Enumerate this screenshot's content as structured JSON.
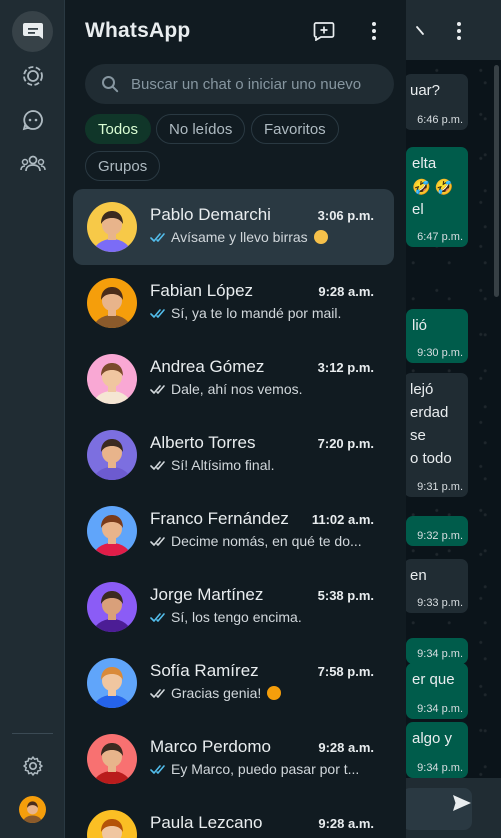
{
  "app": {
    "title": "WhatsApp"
  },
  "rail": {
    "items": [
      "chats-icon",
      "status-icon",
      "channels-icon",
      "communities-icon"
    ],
    "bottom": [
      "settings-icon",
      "profile-avatar"
    ]
  },
  "header": {
    "icons": [
      "new-chat-icon",
      "menu-icon"
    ]
  },
  "search": {
    "placeholder": "Buscar un chat o iniciar uno nuevo"
  },
  "filters": [
    "Todos",
    "No leídos",
    "Favoritos",
    "Grupos"
  ],
  "chats": [
    {
      "name": "Pablo Demarchi",
      "time": "3:06 p.m.",
      "preview": "Avísame y llevo birras",
      "read": true,
      "emoji": "yum",
      "avatar_color": "#f7c948",
      "skin": "#e8b48b",
      "hair": "#3b2a20",
      "shirt": "#7b6cf6"
    },
    {
      "name": "Fabian López",
      "time": "9:28 a.m.",
      "preview": "Sí, ya te lo mandé por mail.",
      "read": true,
      "avatar_color": "#f59e0b",
      "skin": "#e8b48b",
      "hair": "#4a2c1a",
      "shirt": "#8b5a2b"
    },
    {
      "name": "Andrea Gómez",
      "time": "3:12 p.m.",
      "preview": "Dale, ahí nos vemos.",
      "read": false,
      "avatar_color": "#f9a8d4",
      "skin": "#f0c6a0",
      "hair": "#7a4a2a",
      "shirt": "#f5e6d3"
    },
    {
      "name": "Alberto Torres",
      "time": "7:20 p.m.",
      "preview": "Sí! Altísimo final.",
      "read": false,
      "avatar_color": "#7c6fe0",
      "skin": "#e8b48b",
      "hair": "#3b2a20",
      "shirt": "#6d5bd0"
    },
    {
      "name": "Franco Fernández",
      "time": "11:02 a.m.",
      "preview": "Decime nomás, en qué te do...",
      "read": false,
      "avatar_color": "#60a5fa",
      "skin": "#e8b48b",
      "hair": "#7a3b1a",
      "shirt": "#e11d48"
    },
    {
      "name": "Jorge Martínez",
      "time": "5:38 p.m.",
      "preview": "Sí, los tengo encima.",
      "read": true,
      "avatar_color": "#8b5cf6",
      "skin": "#d9a07a",
      "hair": "#3b2a20",
      "shirt": "#4c1d95"
    },
    {
      "name": "Sofía Ramírez",
      "time": "7:58 p.m.",
      "preview": "Gracias genia!",
      "read": false,
      "emoji": "party",
      "avatar_color": "#60a5fa",
      "skin": "#f0c6a0",
      "hair": "#d98a3a",
      "shirt": "#2563eb"
    },
    {
      "name": "Marco Perdomo",
      "time": "9:28 a.m.",
      "preview": "Ey Marco, puedo pasar por t...",
      "read": true,
      "avatar_color": "#f87171",
      "skin": "#e8b48b",
      "hair": "#3b2a20",
      "shirt": "#b91c1c"
    },
    {
      "name": "Paula Lezcano",
      "time": "9:28 a.m.",
      "preview": "",
      "read": false,
      "avatar_color": "#fbbf24",
      "skin": "#f0c6a0",
      "hair": "#b45309",
      "shirt": "#fde68a"
    }
  ],
  "conversation": {
    "bubbles": [
      {
        "dir": "in",
        "lines": [
          "uar?"
        ],
        "time": "6:46 p.m."
      },
      {
        "dir": "out",
        "lines": [
          "elta",
          "🤣 🤣",
          "el"
        ],
        "time": "6:47 p.m."
      },
      {
        "dir": "out",
        "lines": [
          "lió"
        ],
        "time": "9:30 p.m."
      },
      {
        "dir": "in",
        "lines": [
          "lejó",
          "erdad",
          "se",
          "o todo"
        ],
        "time": "9:31 p.m."
      },
      {
        "dir": "out",
        "lines": [
          ""
        ],
        "time": "9:32 p.m."
      },
      {
        "dir": "in",
        "lines": [
          "en"
        ],
        "time": "9:33 p.m."
      },
      {
        "dir": "out",
        "lines": [
          ""
        ],
        "time": "9:34 p.m."
      },
      {
        "dir": "out",
        "lines": [
          "er que"
        ],
        "time": "9:34 p.m."
      },
      {
        "dir": "out",
        "lines": [
          "algo y"
        ],
        "time": "9:34 p.m."
      }
    ],
    "send_icon": "send-icon"
  },
  "colors": {
    "accent": "#00a884",
    "read_check": "#53bdeb",
    "unread_check": "#8696a0",
    "panel": "#111b21",
    "rail": "#202c33"
  }
}
